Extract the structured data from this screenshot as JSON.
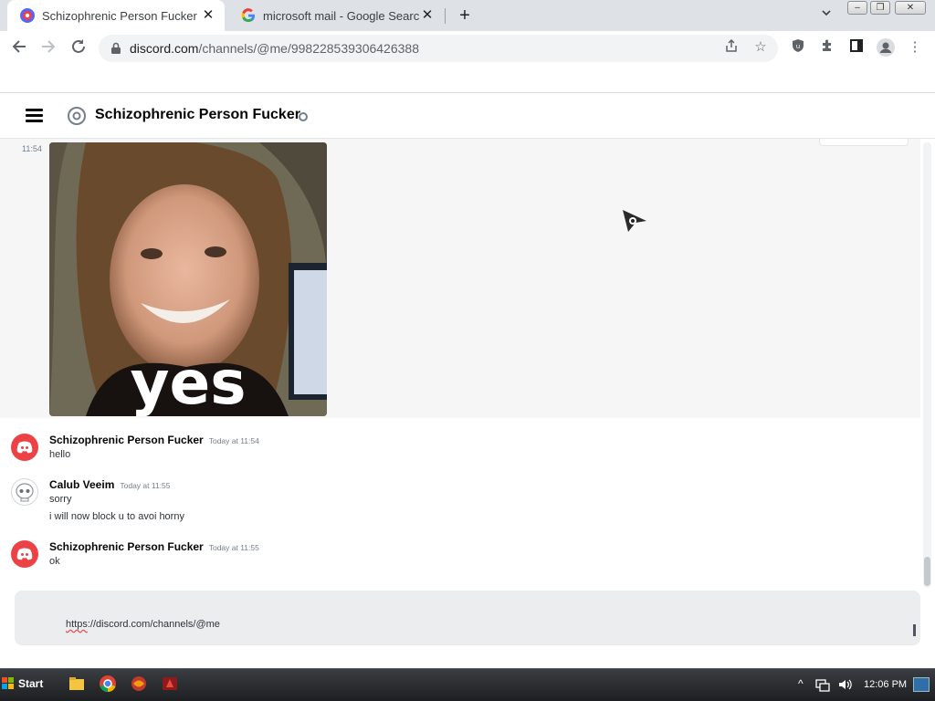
{
  "browser": {
    "tabs": [
      {
        "label": "Schizophrenic Person Fucker",
        "favicon": "discord-favicon",
        "active": true
      },
      {
        "label": "microsoft mail - Google Search",
        "favicon": "google-favicon",
        "active": false
      }
    ],
    "close_glyph": "✕",
    "new_tab_glyph": "+",
    "url_host": "discord.com",
    "url_path": "/channels/@me/998228539306426388"
  },
  "channel": {
    "title": "Schizophrenic Person Fucker",
    "status_color": "#747f8d"
  },
  "messages": {
    "first_timestamp": "11:54",
    "image_caption": "yes",
    "items": [
      {
        "author": "Schizophrenic Person Fucker",
        "time": "Today at 11:54",
        "avatar": "discord-logo-icon",
        "lines": [
          "hello"
        ]
      },
      {
        "author": "Calub Veeim",
        "time": "Today at 11:55",
        "avatar": "skull-avatar-icon",
        "lines": [
          "sorry",
          "i will now block u to avoi horny"
        ]
      },
      {
        "author": "Schizophrenic Person Fucker",
        "time": "Today at 11:55",
        "avatar": "discord-logo-icon",
        "lines": [
          "ok"
        ]
      }
    ]
  },
  "composer": {
    "text_underlined": "https",
    "text_rest": "://discord.com/channels/@me"
  },
  "taskbar": {
    "start_label": "Start",
    "clock": "12:06 PM"
  },
  "colors": {
    "discord_red": "#ed4245",
    "chrome_tabstrip": "#dee1e6",
    "composer_bg": "#ebedef"
  }
}
